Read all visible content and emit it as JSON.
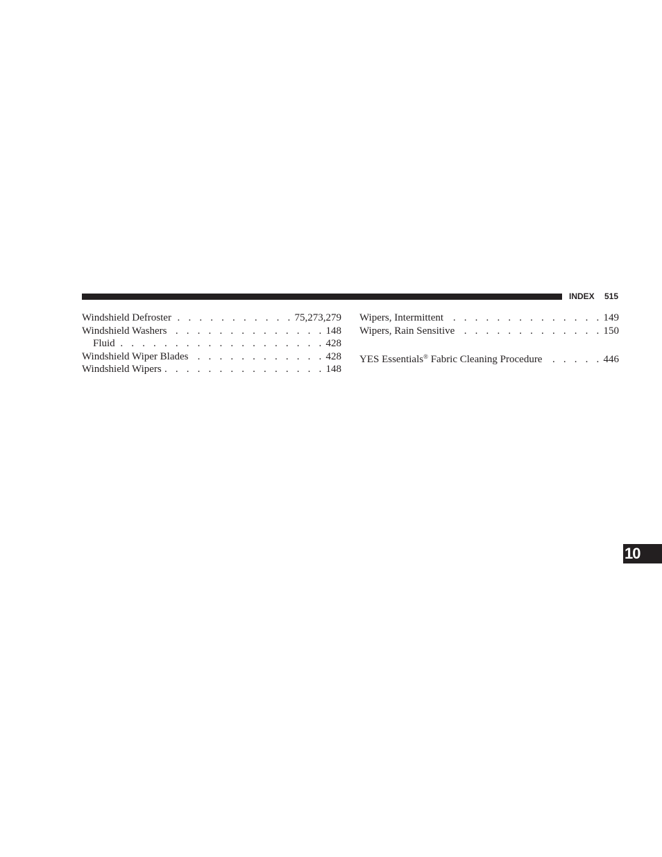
{
  "header": {
    "section": "INDEX",
    "page_number": "515"
  },
  "left_column": {
    "entries": [
      {
        "term": "Windshield Defroster",
        "pages": "75,273,279",
        "indent": false
      },
      {
        "term": "Windshield Washers",
        "pages": "148",
        "indent": false
      },
      {
        "term": "Fluid",
        "pages": "428",
        "indent": true
      },
      {
        "term": "Windshield Wiper Blades",
        "pages": "428",
        "indent": false
      },
      {
        "term": "Windshield Wipers",
        "pages": "148",
        "indent": false
      }
    ]
  },
  "right_column": {
    "entries": [
      {
        "term": "Wipers, Intermittent",
        "pages": "149"
      },
      {
        "term": "Wipers, Rain Sensitive",
        "pages": "150"
      },
      {
        "term_before": "YES Essentials",
        "term_mark": "®",
        "term_after": " Fabric Cleaning Procedure",
        "pages": "446"
      }
    ]
  },
  "chapter_tab": {
    "label": "10"
  },
  "leader": ". . . . . . . . . . . . . . . . . . . . . . . . . . . . . . . . . . . . . . . . . . . . . . . . . . ."
}
